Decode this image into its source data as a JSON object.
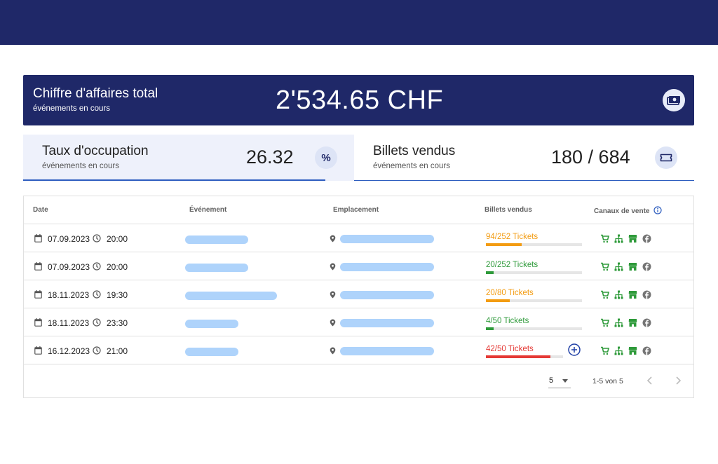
{
  "revenue": {
    "title": "Chiffre d'affaires total",
    "subtitle": "événements en cours",
    "value": "2'534.65 CHF",
    "icon": "money-icon"
  },
  "occupancy": {
    "title": "Taux d'occupation",
    "subtitle": "événements en cours",
    "value": "26.32",
    "icon_glyph": "%"
  },
  "tickets_sold": {
    "title": "Billets vendus",
    "subtitle": "événements en cours",
    "value": "180 / 684",
    "icon": "ticket-icon"
  },
  "table": {
    "headers": {
      "date": "Date",
      "event": "Événement",
      "location": "Emplacement",
      "tickets": "Billets vendus",
      "channels": "Canaux de vente"
    },
    "rows": [
      {
        "date": "07.09.2023",
        "time": "20:00",
        "tickets": "94/252 Tickets",
        "sold": 94,
        "capacity": 252,
        "status_color": "#f39c12"
      },
      {
        "date": "07.09.2023",
        "time": "20:00",
        "tickets": "20/252 Tickets",
        "sold": 20,
        "capacity": 252,
        "status_color": "#2e9a3a"
      },
      {
        "date": "18.11.2023",
        "time": "19:30",
        "tickets": "20/80 Tickets",
        "sold": 20,
        "capacity": 80,
        "status_color": "#f39c12"
      },
      {
        "date": "18.11.2023",
        "time": "23:30",
        "tickets": "4/50 Tickets",
        "sold": 4,
        "capacity": 50,
        "status_color": "#2e9a3a"
      },
      {
        "date": "16.12.2023",
        "time": "21:00",
        "tickets": "42/50 Tickets",
        "sold": 42,
        "capacity": 50,
        "status_color": "#e53935"
      }
    ],
    "channel_icons": [
      "cart-icon",
      "network-icon",
      "store-icon",
      "facebook-icon"
    ],
    "channel_color": "#2e9a3a"
  },
  "pagination": {
    "per_page": "5",
    "range": "1-5 von 5"
  },
  "colors": {
    "navy": "#1f2868",
    "accent_blue": "#2d5dbf",
    "redaction": "#aed3fb"
  }
}
